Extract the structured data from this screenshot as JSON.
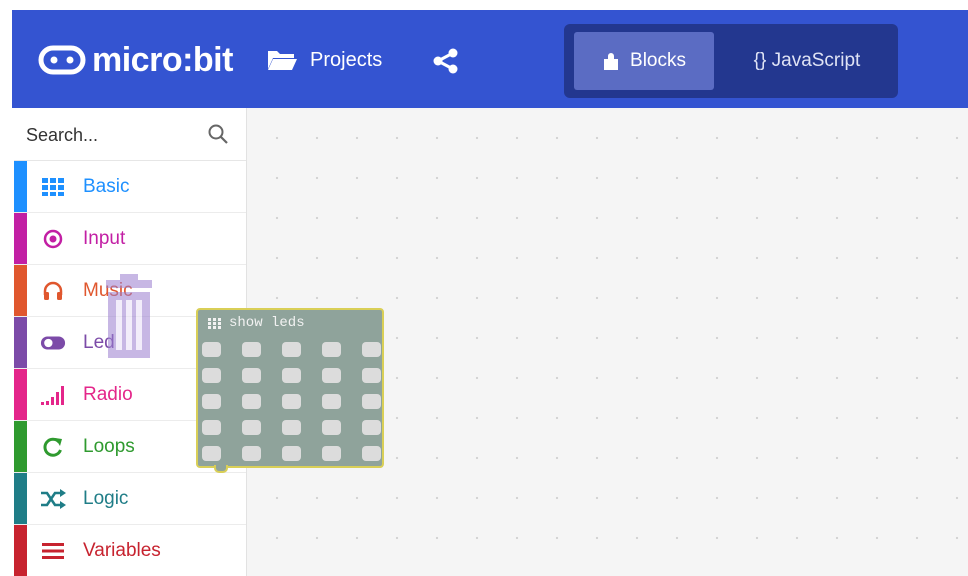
{
  "header": {
    "brand": "micro:bit",
    "projects_label": "Projects",
    "tabs": [
      {
        "label": "Blocks",
        "active": true
      },
      {
        "label": "{} JavaScript",
        "active": false
      }
    ]
  },
  "toolbox": {
    "search_placeholder": "Search...",
    "categories": [
      {
        "label": "Basic",
        "color": "#1e90ff",
        "icon": "grid-icon"
      },
      {
        "label": "Input",
        "color": "#c21fa4",
        "icon": "target-icon"
      },
      {
        "label": "Music",
        "color": "#e0572e",
        "icon": "headphones-icon"
      },
      {
        "label": "Led",
        "color": "#7c4ba8",
        "icon": "toggle-icon"
      },
      {
        "label": "Radio",
        "color": "#e4268a",
        "icon": "signal-bars-icon"
      },
      {
        "label": "Loops",
        "color": "#2f9a2f",
        "icon": "refresh-icon"
      },
      {
        "label": "Logic",
        "color": "#1f7d87",
        "icon": "shuffle-icon"
      },
      {
        "label": "Variables",
        "color": "#c7232f",
        "icon": "list-lines-icon"
      }
    ]
  },
  "workspace": {
    "block": {
      "label": "show leds",
      "rows": 5,
      "cols": 5
    }
  },
  "colors": {
    "header_bg": "#3454d1",
    "mode_switch_bg": "#23378f",
    "active_tab_bg": "#5b6cc3",
    "block_bg": "#8fa39b",
    "block_border": "#d9cf57"
  }
}
